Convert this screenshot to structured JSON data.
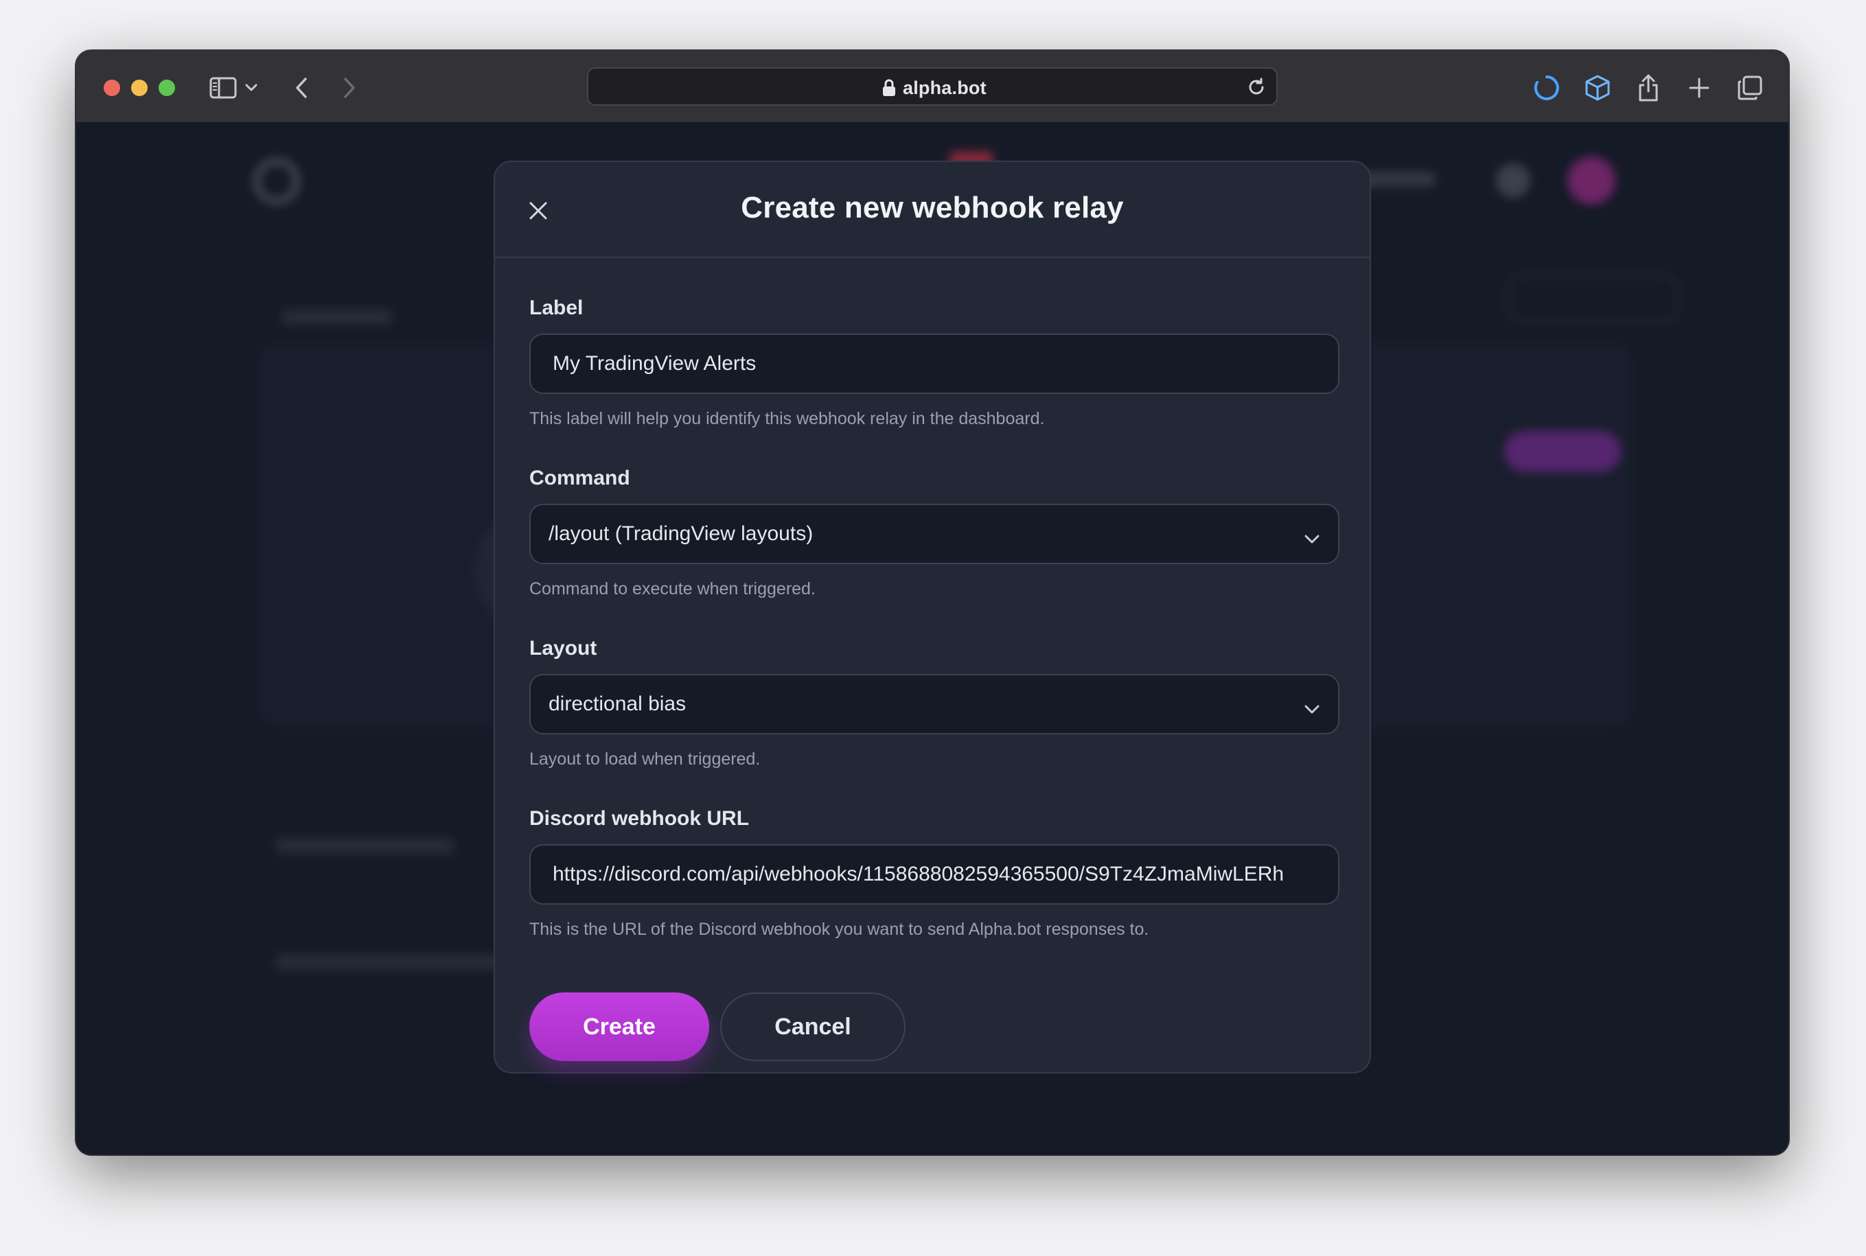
{
  "browser": {
    "url": "alpha.bot"
  },
  "modal": {
    "title": "Create new webhook relay",
    "fields": {
      "label": {
        "label": "Label",
        "value": "My TradingView Alerts",
        "help": "This label will help you identify this webhook relay in the dashboard."
      },
      "command": {
        "label": "Command",
        "value": "/layout (TradingView layouts)",
        "help": "Command to execute when triggered."
      },
      "layout": {
        "label": "Layout",
        "value": "directional bias",
        "help": "Layout to load when triggered."
      },
      "webhook_url": {
        "label": "Discord webhook URL",
        "value": "https://discord.com/api/webhooks/1158688082594365500/S9Tz4ZJmaMiwLERh",
        "help": "This is the URL of the Discord webhook you want to send Alpha.bot responses to."
      }
    },
    "buttons": {
      "create": "Create",
      "cancel": "Cancel"
    }
  },
  "colors": {
    "accent": "#b537d6",
    "modal_bg": "#232836",
    "input_bg": "#151a27"
  }
}
